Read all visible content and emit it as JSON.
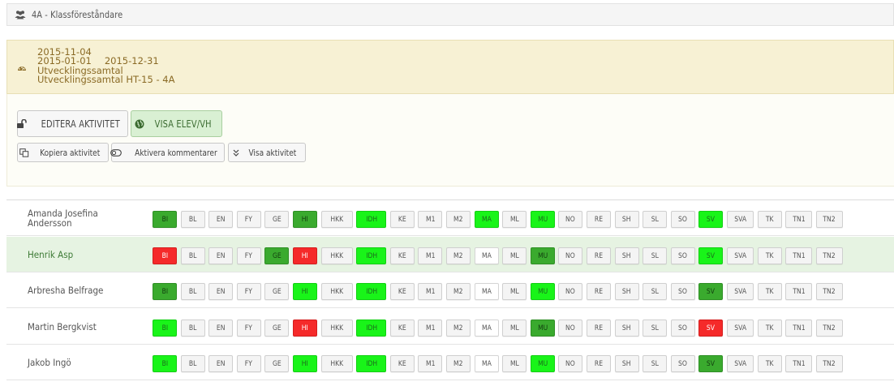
{
  "header": {
    "title": "4A - Klassföreståndare",
    "icon": "users-icon"
  },
  "info": {
    "date": "2015-11-04",
    "range_start": "2015-01-01",
    "range_end": "2015-12-31",
    "type": "Utvecklingssamtal",
    "name": "Utvecklingssamtal HT-15 - 4A",
    "icon": "dashboard-icon"
  },
  "toolbar": {
    "edit_label": "EDITERA AKTIVITET",
    "view_label": "VISA ELEV/VH",
    "copy_label": "Kopiera aktivitet",
    "comments_label": "Aktivera kommentarer",
    "show_label": "Visa aktivitet"
  },
  "colors": {
    "light_green": "#19f419",
    "dark_green": "#3aaa2e",
    "red": "#f52a2a",
    "default": "#f4f4f4",
    "white": "#ffffff",
    "selected_row": "#e6f3e2"
  },
  "subjects": [
    "BI",
    "BL",
    "EN",
    "FY",
    "GE",
    "HI",
    "HKK",
    "IDH",
    "KE",
    "M1",
    "M2",
    "MA",
    "ML",
    "MU",
    "NO",
    "RE",
    "SH",
    "SL",
    "SO",
    "SV",
    "SVA",
    "TK",
    "TN1",
    "TN2"
  ],
  "students": [
    {
      "name": "Amanda Josefina Andersson",
      "selected": false,
      "status": [
        "dg",
        "",
        "",
        "",
        "",
        "dg",
        "",
        "lg",
        "",
        "",
        "",
        "lg",
        "",
        "lg",
        "",
        "",
        "",
        "",
        "",
        "lg",
        "",
        "",
        "",
        ""
      ]
    },
    {
      "name": "Henrik Asp",
      "selected": true,
      "status": [
        "rd",
        "",
        "",
        "",
        "dg",
        "rd",
        "",
        "lg",
        "",
        "",
        "",
        "wh",
        "",
        "dg",
        "",
        "",
        "",
        "",
        "",
        "lg",
        "",
        "",
        "",
        ""
      ]
    },
    {
      "name": "Arbresha Belfrage",
      "selected": false,
      "status": [
        "dg",
        "",
        "",
        "",
        "",
        "lg",
        "",
        "lg",
        "",
        "",
        "",
        "wh",
        "",
        "lg",
        "",
        "",
        "",
        "",
        "",
        "dg",
        "",
        "",
        "",
        ""
      ]
    },
    {
      "name": "Martin Bergkvist",
      "selected": false,
      "status": [
        "lg",
        "",
        "",
        "",
        "",
        "rd",
        "",
        "lg",
        "",
        "",
        "",
        "wh",
        "",
        "dg",
        "",
        "",
        "",
        "",
        "",
        "rd",
        "",
        "",
        "",
        ""
      ]
    },
    {
      "name": "Jakob Ingö",
      "selected": false,
      "status": [
        "lg",
        "",
        "",
        "",
        "",
        "lg",
        "",
        "lg",
        "",
        "",
        "",
        "wh",
        "",
        "lg",
        "",
        "",
        "",
        "",
        "",
        "dg",
        "",
        "",
        "",
        ""
      ]
    }
  ]
}
